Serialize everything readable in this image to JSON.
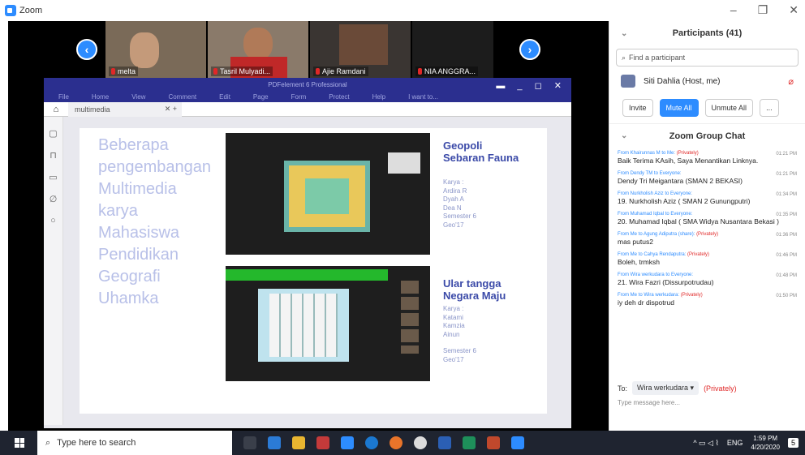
{
  "app": {
    "title": "Zoom",
    "brand_color": "#2d8cff"
  },
  "videos": [
    {
      "name": "melta",
      "bg": "#7a6a58"
    },
    {
      "name": "Tasril Mulyadi...",
      "bg": "#8a7a6a"
    },
    {
      "name": "Ajie Ramdani",
      "bg": "#3a3532"
    },
    {
      "name": "NIA ANGGRA...",
      "bg": "#1c1c1c"
    }
  ],
  "pdf": {
    "title": "PDFelement 6 Professional",
    "menu": [
      "File",
      "Home",
      "View",
      "Comment",
      "Edit",
      "Page",
      "Form",
      "Protect",
      "Help"
    ],
    "help_search": "I want to...",
    "tab": "multimedia",
    "page": {
      "heading": "Beberapa pengembangan Multimedia karya Mahasiswa Pendidikan Geografi Uhamka",
      "item1_title": "Geopoli Sebaran Fauna",
      "item1_meta": [
        "Karya :",
        "Ardira R",
        "Dyah A",
        "Dea N",
        "Semester 6",
        "Geo'17"
      ],
      "item2_title": "Ular tangga Negara Maju",
      "item2_meta": [
        "Karya :",
        "Katami",
        "Kamzia",
        "Ainun",
        "",
        "Semester 6",
        "Geo'17"
      ]
    }
  },
  "participants": {
    "header": "Participants (41)",
    "search_placeholder": "Find a participant",
    "host": "Siti Dahlia (Host, me)",
    "buttons": {
      "invite": "Invite",
      "mute_all": "Mute All",
      "unmute_all": "Unmute All",
      "more": "..."
    }
  },
  "chat": {
    "header": "Zoom Group Chat",
    "messages": [
      {
        "from": "From Khairunnas M to Me:",
        "private": "(Privately)",
        "time": "01:21 PM",
        "text": "Baik Terima KAsih, Saya Menantikan Linknya."
      },
      {
        "from": "From Dendy TM to Everyone:",
        "private": "",
        "time": "01:21 PM",
        "text": "Dendy Tri Meigantara (SMAN 2 BEKASI)"
      },
      {
        "from": "From Nurkholish Aziz to Everyone:",
        "private": "",
        "time": "01:34 PM",
        "text": "19. Nurkholish Aziz ( SMAN 2 Gunungputri)"
      },
      {
        "from": "From Muhamad Iqbal to Everyone:",
        "private": "",
        "time": "01:35 PM",
        "text": "20. Muhamad Iqbal ( SMA Widya Nusantara Bekasi )"
      },
      {
        "from": "From Me to Agung Adiputra (share):",
        "private": "(Privately)",
        "time": "01:36 PM",
        "text": "mas putus2"
      },
      {
        "from": "From Me to Cahya Rendaputra:",
        "private": "(Privately)",
        "time": "01:46 PM",
        "text": "Boleh, trmksh"
      },
      {
        "from": "From Wira werkudara to Everyone:",
        "private": "",
        "time": "01:48 PM",
        "text": "21. Wira Fazri (Dissurpotrudau)"
      },
      {
        "from": "From Me to Wira werkudara:",
        "private": "(Privately)",
        "time": "01:50 PM",
        "text": "iy deh dr dispotrud"
      }
    ],
    "to_label": "To:",
    "to_value": "Wira werkudara ▾",
    "to_private": "(Privately)",
    "input_placeholder": "Type message here..."
  },
  "taskbar": {
    "search": "Type here to search",
    "lang": "ENG",
    "time": "1:59 PM",
    "date": "4/20/2020",
    "notif": "5"
  },
  "icons": [
    "windows-icon",
    "search-icon",
    "home-icon",
    "chevron-left-icon",
    "chevron-right-icon",
    "mic-muted-icon",
    "close-icon"
  ]
}
